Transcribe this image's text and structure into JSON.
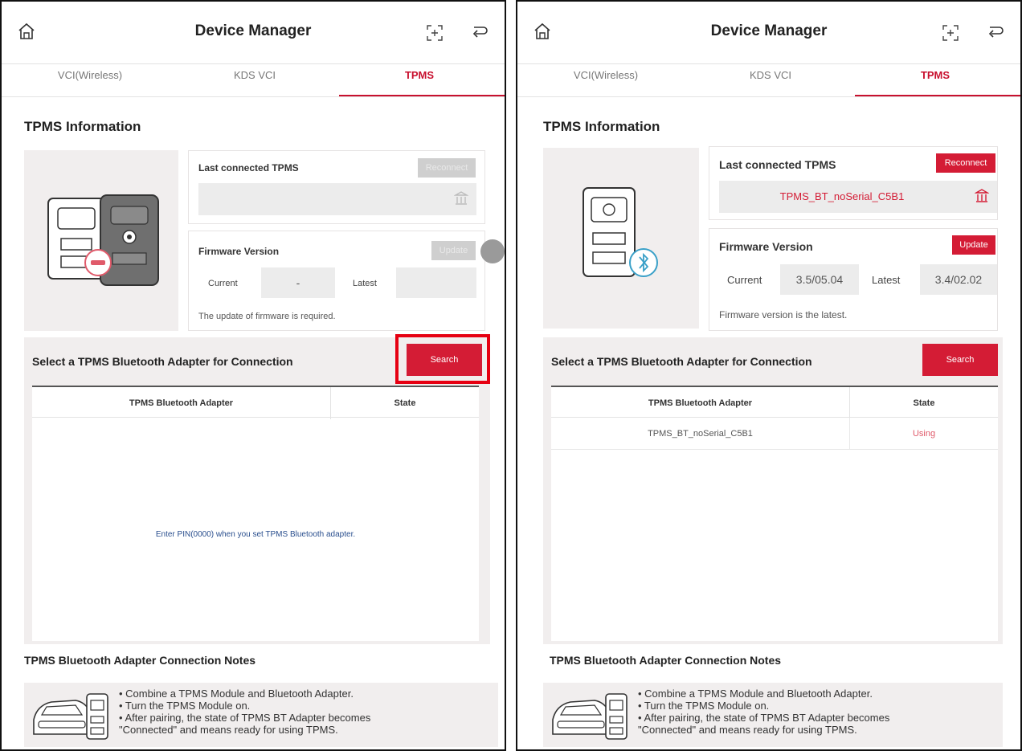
{
  "panels": [
    {
      "header": {
        "title": "Device Manager",
        "icons": [
          "home-icon",
          "scan-icon",
          "back-icon"
        ]
      },
      "tabs": [
        "VCI(Wireless)",
        "KDS VCI",
        "TPMS"
      ],
      "active_tab": "TPMS",
      "info_title": "TPMS Information",
      "last_card": {
        "title": "Last connected TPMS",
        "button": "Reconnect",
        "device_name": ""
      },
      "fw_card": {
        "title": "Firmware Version",
        "button": "Update",
        "current_label": "Current",
        "current_value": "-",
        "latest_label": "Latest",
        "latest_value": "",
        "message": "The update of firmware is required."
      },
      "conn": {
        "title": "Select a TPMS Bluetooth Adapter for Connection",
        "search_label": "Search",
        "col_adapter": "TPMS Bluetooth Adapter",
        "col_state": "State",
        "rows": [],
        "empty_message": "Enter PIN(0000) when you set TPMS Bluetooth adapter."
      },
      "notes": {
        "title": "TPMS Bluetooth Adapter Connection Notes",
        "lines": [
          "• Combine a TPMS Module and Bluetooth Adapter.",
          "• Turn the TPMS Module on.",
          "• After pairing, the state of TPMS BT Adapter becomes",
          "\"Connected\" and means ready for using TPMS."
        ]
      }
    },
    {
      "header": {
        "title": "Device Manager",
        "icons": [
          "home-icon",
          "scan-icon",
          "back-icon"
        ]
      },
      "tabs": [
        "VCI(Wireless)",
        "KDS VCI",
        "TPMS"
      ],
      "active_tab": "TPMS",
      "info_title": "TPMS Information",
      "last_card": {
        "title": "Last connected TPMS",
        "button": "Reconnect",
        "device_name": "TPMS_BT_noSerial_C5B1"
      },
      "fw_card": {
        "title": "Firmware Version",
        "button": "Update",
        "current_label": "Current",
        "current_value": "3.5/05.04",
        "latest_label": "Latest",
        "latest_value": "3.4/02.02",
        "message": "Firmware version is the latest."
      },
      "conn": {
        "title": "Select a TPMS Bluetooth Adapter for Connection",
        "search_label": "Search",
        "col_adapter": "TPMS Bluetooth Adapter",
        "col_state": "State",
        "rows": [
          {
            "adapter": "TPMS_BT_noSerial_C5B1",
            "state": "Using"
          }
        ],
        "empty_message": ""
      },
      "notes": {
        "title": "TPMS Bluetooth Adapter Connection Notes",
        "lines": [
          "• Combine a TPMS Module and Bluetooth Adapter.",
          "• Turn the TPMS Module on.",
          "• After pairing, the state of TPMS BT Adapter becomes",
          "\"Connected\" and means ready for using TPMS."
        ]
      }
    }
  ],
  "colors": {
    "accent": "#d41c35",
    "highlight": "#e60012",
    "disabled": "#cfcfcf",
    "panel_bg": "#f1eeee"
  }
}
